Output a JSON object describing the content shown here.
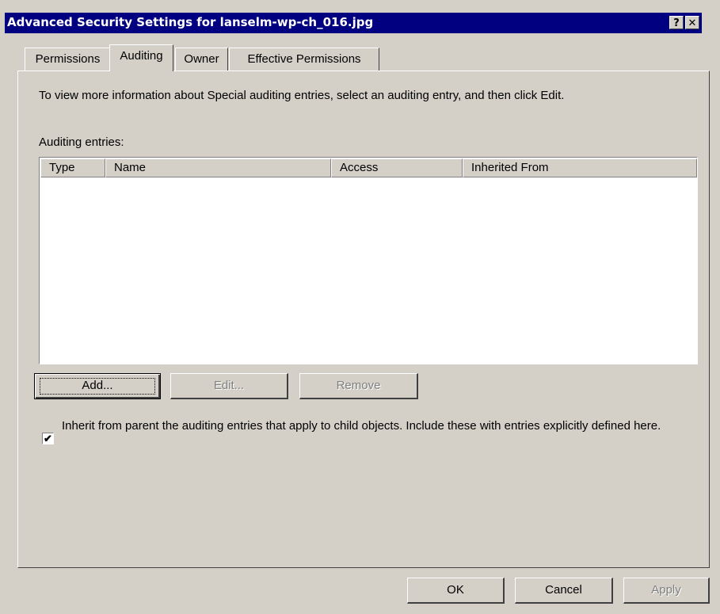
{
  "window": {
    "title": "Advanced Security Settings for lanselm-wp-ch_016.jpg",
    "help_button": "?",
    "close_button": "✕"
  },
  "tabs": [
    {
      "label": "Permissions",
      "active": false
    },
    {
      "label": "Auditing",
      "active": true
    },
    {
      "label": "Owner",
      "active": false
    },
    {
      "label": "Effective Permissions",
      "active": false
    }
  ],
  "auditing": {
    "info_text": "To view more information about Special auditing entries, select an auditing entry, and then click Edit.",
    "entries_label": "Auditing entries:",
    "columns": [
      "Type",
      "Name",
      "Access",
      "Inherited From"
    ],
    "rows": [],
    "add_label": "Add...",
    "edit_label": "Edit...",
    "remove_label": "Remove",
    "inherit_checked": true,
    "inherit_label": "Inherit from parent the auditing entries that apply to child objects. Include these with entries explicitly defined here."
  },
  "footer": {
    "ok_label": "OK",
    "cancel_label": "Cancel",
    "apply_label": "Apply"
  },
  "colors": {
    "titlebar": "#000080",
    "face": "#d4d0c8"
  }
}
